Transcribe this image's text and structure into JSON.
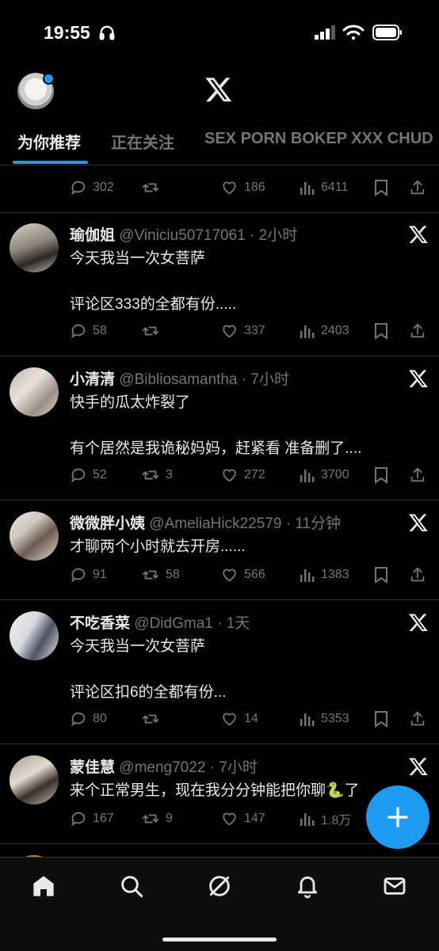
{
  "status": {
    "time": "19:55"
  },
  "tabs": [
    {
      "label": "为你推荐"
    },
    {
      "label": "正在关注"
    },
    {
      "label": "SEX PORN BOKEP XXX CHUD"
    }
  ],
  "partial_post": {
    "stats": {
      "comments": "302",
      "reposts": "",
      "likes": "186",
      "views": "6411"
    }
  },
  "posts": [
    {
      "name": "瑜伽姐",
      "meta": "@Viniciu50717061 · 2小时",
      "text": "今天我当一次女菩萨\n\n评论区333的全都有份.....",
      "stats": {
        "comments": "58",
        "reposts": "",
        "likes": "337",
        "views": "2403"
      }
    },
    {
      "name": "小清清",
      "meta": "@Bibliosamantha · 7小时",
      "text": "快手的瓜太炸裂了\n\n有个居然是我诡秘妈妈，赶紧看 准备删了....",
      "stats": {
        "comments": "52",
        "reposts": "3",
        "likes": "272",
        "views": "3700"
      }
    },
    {
      "name": "微微胖小姨",
      "meta": "@AmeliaHick22579 · 11分钟",
      "text": "才聊两个小时就去开房......",
      "stats": {
        "comments": "91",
        "reposts": "58",
        "likes": "566",
        "views": "1383"
      }
    },
    {
      "name": "不吃香菜",
      "meta": "@DidGma1 · 1天",
      "text": "今天我当一次女菩萨\n\n评论区扣6的全都有份...",
      "stats": {
        "comments": "80",
        "reposts": "",
        "likes": "14",
        "views": "5353"
      }
    },
    {
      "name": "蒙佳慧",
      "meta": "@meng7022 · 7小时",
      "text": "来个正常男生，现在我分分钟能把你聊🐍了",
      "stats": {
        "comments": "167",
        "reposts": "9",
        "likes": "147",
        "views": "1.8万"
      }
    }
  ],
  "icons": {
    "accent": "#1d9bf0",
    "muted": "#71767b"
  }
}
